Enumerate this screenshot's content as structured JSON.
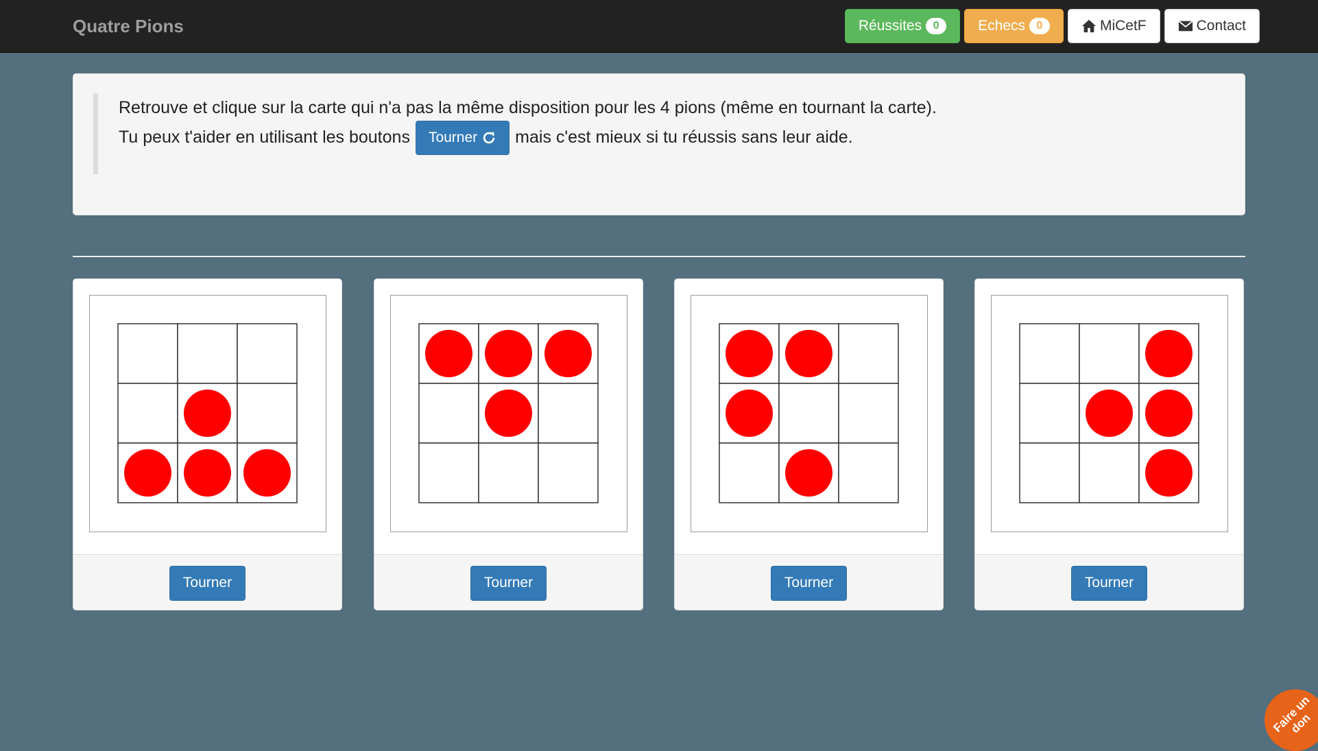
{
  "navbar": {
    "brand": "Quatre Pions",
    "success_label": "Réussites",
    "success_count": "0",
    "fail_label": "Echecs",
    "fail_count": "0",
    "home_label": "MiCetF",
    "contact_label": "Contact"
  },
  "instructions": {
    "line1": "Retrouve et clique sur la carte qui n'a pas la même disposition pour les 4 pions (même en tournant la carte).",
    "line2_before": "Tu peux t'aider en utilisant les boutons",
    "inline_button": "Tourner",
    "line2_after": "mais c'est mieux si tu réussis sans leur aide."
  },
  "colors": {
    "pawn": "#ff0000",
    "background": "#546f7e",
    "primary": "#337ab7",
    "success": "#5cb85c",
    "warning": "#f0ad4e"
  },
  "cards": [
    {
      "pawns": [
        [
          0,
          0,
          0
        ],
        [
          0,
          1,
          0
        ],
        [
          1,
          1,
          1
        ]
      ],
      "button": "Tourner"
    },
    {
      "pawns": [
        [
          1,
          1,
          1
        ],
        [
          0,
          1,
          0
        ],
        [
          0,
          0,
          0
        ]
      ],
      "button": "Tourner"
    },
    {
      "pawns": [
        [
          1,
          1,
          0
        ],
        [
          1,
          0,
          0
        ],
        [
          0,
          1,
          0
        ]
      ],
      "button": "Tourner"
    },
    {
      "pawns": [
        [
          0,
          0,
          1
        ],
        [
          0,
          1,
          1
        ],
        [
          0,
          0,
          1
        ]
      ],
      "button": "Tourner"
    }
  ],
  "donate": {
    "label": "Faire un don"
  }
}
